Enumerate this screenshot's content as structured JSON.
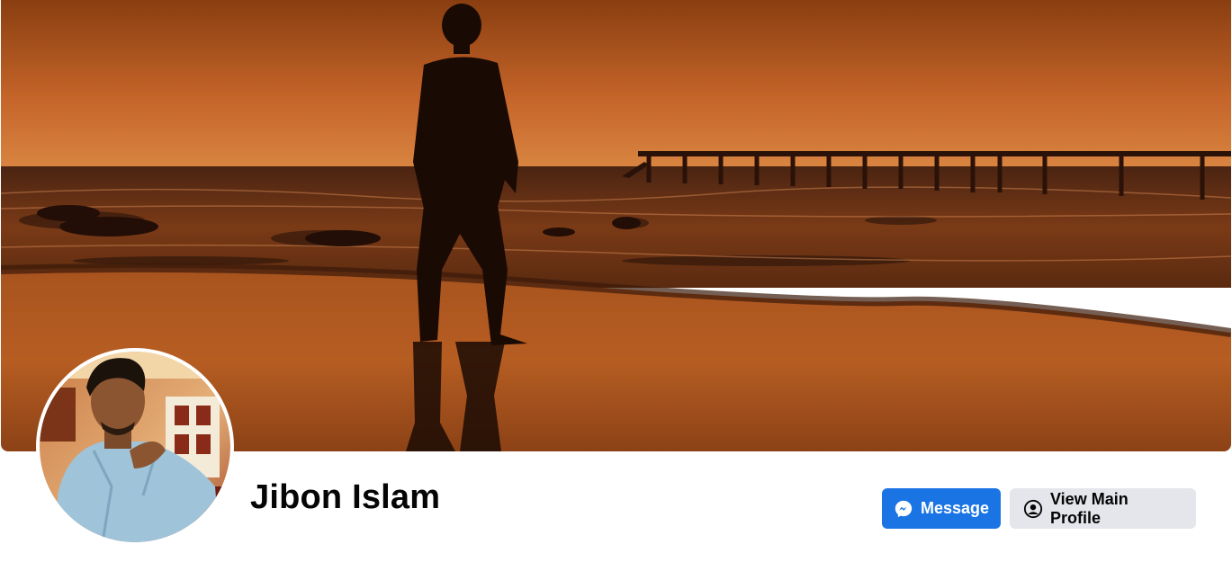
{
  "profile": {
    "name": "Jibon Islam",
    "cover_description_icon": "beach-sunset-cover",
    "avatar_icon": "profile-photo"
  },
  "actions": {
    "message_label": "Message",
    "message_icon": "messenger-icon",
    "view_main_profile_label": "View Main Profile",
    "view_main_profile_icon": "user-circle-icon"
  },
  "colors": {
    "primary": "#1b74e4",
    "secondary_button": "#e4e6eb",
    "text": "#050505",
    "sky_top": "#8a3e10",
    "sky_mid": "#d67a33"
  }
}
